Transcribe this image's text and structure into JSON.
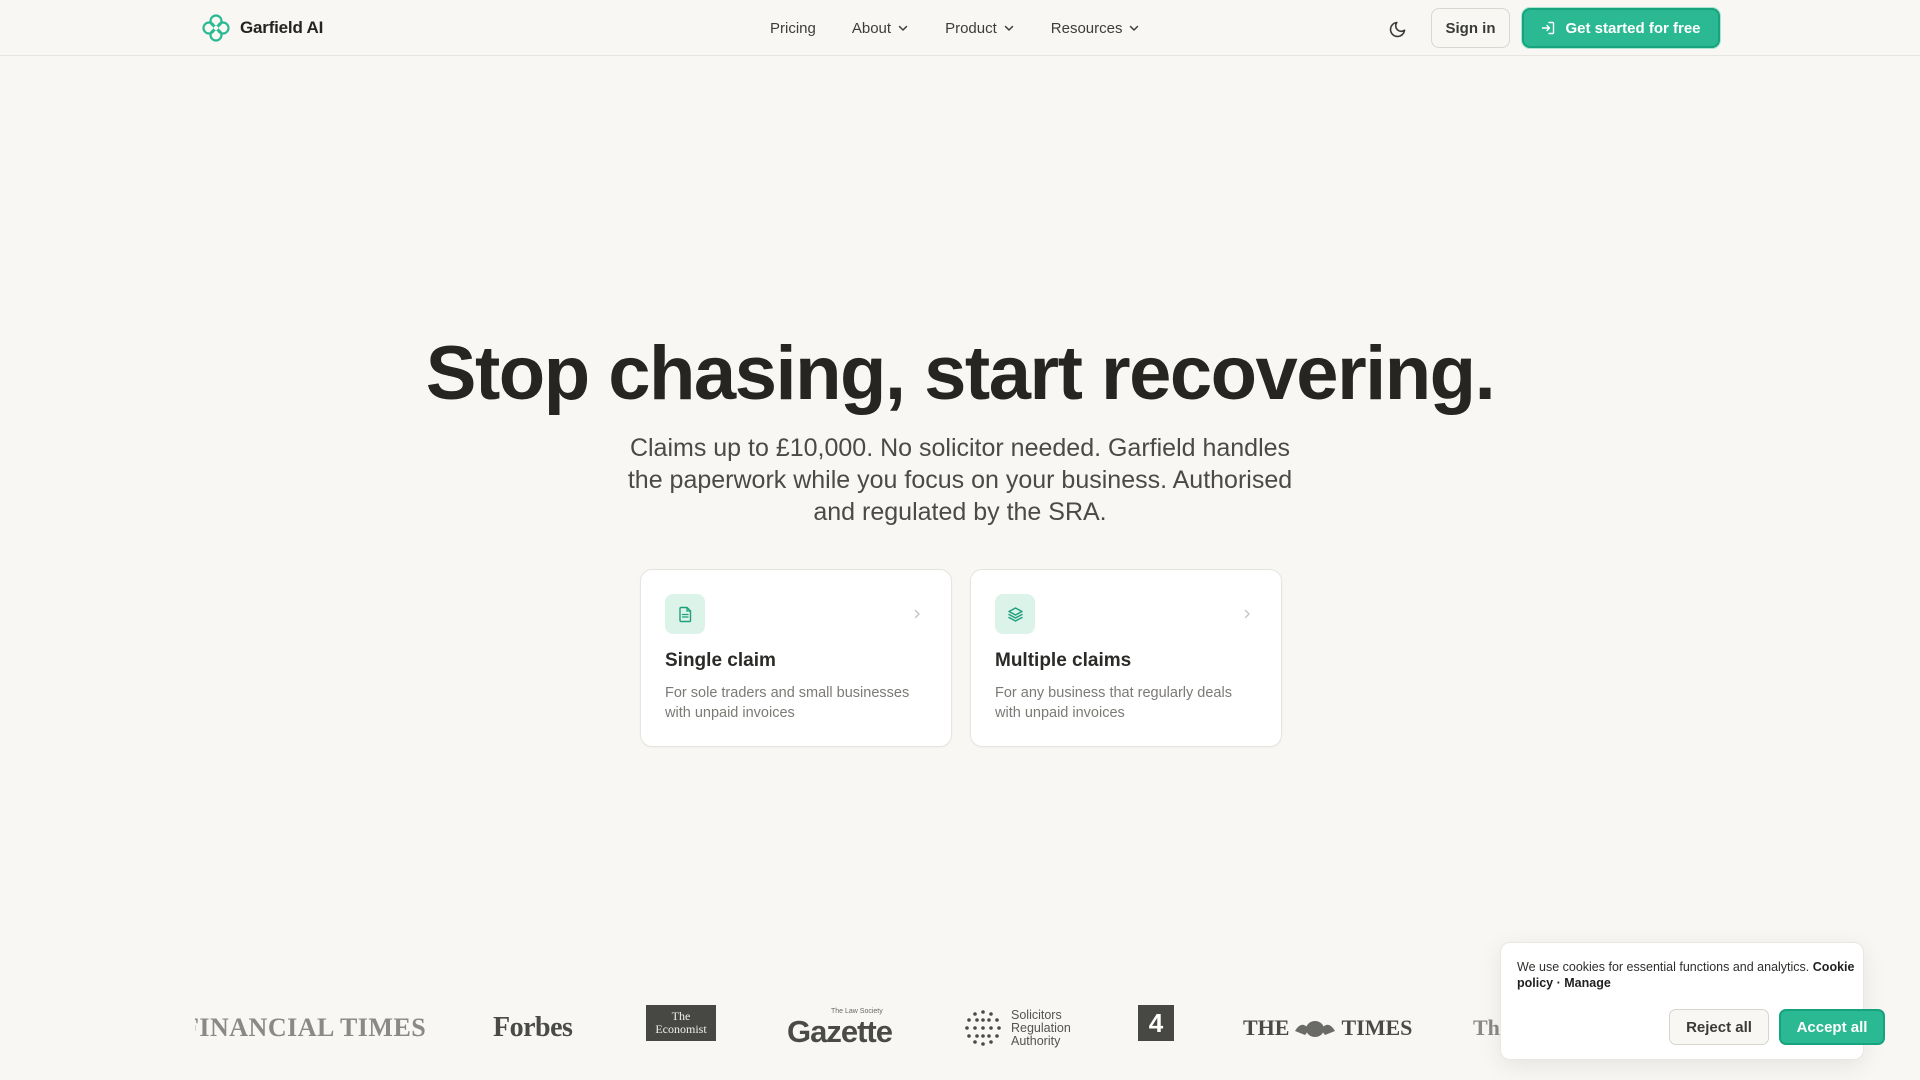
{
  "nav": {
    "brand": "Garfield AI",
    "links": [
      {
        "label": "Pricing",
        "has_dropdown": false
      },
      {
        "label": "About",
        "has_dropdown": true
      },
      {
        "label": "Product",
        "has_dropdown": true
      },
      {
        "label": "Resources",
        "has_dropdown": true
      }
    ],
    "theme_icon": "moon-icon",
    "signin_label": "Sign in",
    "cta_label": "Get started for free",
    "cta_icon": "sign-in-icon"
  },
  "hero": {
    "title": "Stop chasing, start recovering.",
    "subtitle": "Claims up to £10,000. No solicitor needed. Garfield handles the paperwork while you focus on your business. Authorised and regulated by the SRA."
  },
  "cards": [
    {
      "icon": "document-icon",
      "title": "Single claim",
      "description": "For sole traders and small businesses with unpaid invoices"
    },
    {
      "icon": "layers-icon",
      "title": "Multiple claims",
      "description": "For any business that regularly deals with unpaid invoices"
    }
  ],
  "press_logos": {
    "ft": "FINANCIAL TIMES",
    "forbes": "Forbes",
    "economist_line1": "The",
    "economist_line2": "Economist",
    "gazette_small": "The Law Society",
    "gazette": "Gazette",
    "sra_line1": "Solicitors",
    "sra_line2": "Regulation",
    "sra_line3": "Authority",
    "channel4": "4",
    "times_left": "THE",
    "times_right": "TIMES",
    "times_partial": "Th"
  },
  "cookie": {
    "text": "We use cookies for essential functions and analytics.",
    "policy_link": "Cookie policy",
    "separator": "·",
    "manage_link": "Manage",
    "reject_label": "Reject all",
    "accept_label": "Accept all"
  },
  "colors": {
    "accent": "#2ab992",
    "background": "#f8f7f3",
    "text": "#262522"
  }
}
